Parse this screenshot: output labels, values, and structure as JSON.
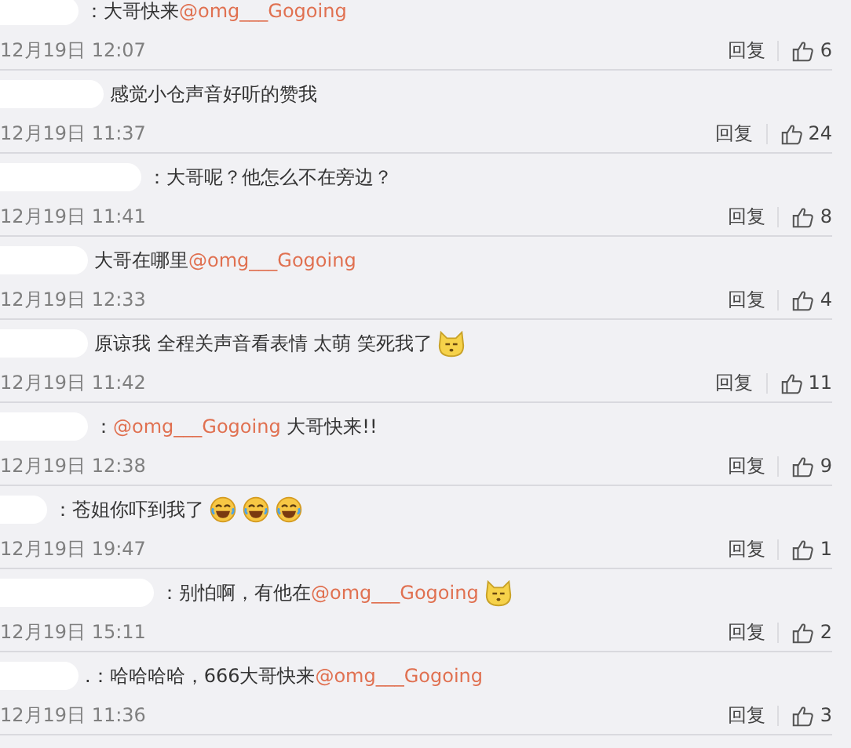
{
  "comments": [
    {
      "content": [
        {
          "kind": "text",
          "text": "：大哥快来"
        },
        {
          "kind": "mention",
          "text": "@omg___Gogoing"
        }
      ],
      "time": "12月19日 12:07",
      "reply": "回复",
      "likes": "6"
    },
    {
      "content": [
        {
          "kind": "text",
          "text": "感觉小仓声音好听的赞我"
        }
      ],
      "time": "12月19日 11:37",
      "reply": "回复",
      "likes": "24"
    },
    {
      "content": [
        {
          "kind": "text",
          "text": "：大哥呢？他怎么不在旁边？"
        }
      ],
      "time": "12月19日 11:41",
      "reply": "回复",
      "likes": "8"
    },
    {
      "content": [
        {
          "kind": "text",
          "text": "大哥在哪里"
        },
        {
          "kind": "mention",
          "text": "@omg___Gogoing"
        }
      ],
      "time": "12月19日 12:33",
      "reply": "回复",
      "likes": "4"
    },
    {
      "content": [
        {
          "kind": "text",
          "text": "原谅我 全程关声音看表情 太萌 笑死我了"
        },
        {
          "kind": "doge"
        }
      ],
      "time": "12月19日 11:42",
      "reply": "回复",
      "likes": "11"
    },
    {
      "content": [
        {
          "kind": "text",
          "text": "："
        },
        {
          "kind": "mention",
          "text": "@omg___Gogoing"
        },
        {
          "kind": "text",
          "text": " 大哥快来!!"
        }
      ],
      "time": "12月19日 12:38",
      "reply": "回复",
      "likes": "9"
    },
    {
      "content": [
        {
          "kind": "text",
          "text": "：苍姐你吓到我了"
        },
        {
          "kind": "laugh"
        },
        {
          "kind": "laugh"
        },
        {
          "kind": "laugh"
        }
      ],
      "time": "12月19日 19:47",
      "reply": "回复",
      "likes": "1"
    },
    {
      "content": [
        {
          "kind": "text",
          "text": "：别怕啊，有他在"
        },
        {
          "kind": "mention",
          "text": "@omg___Gogoing"
        },
        {
          "kind": "doge"
        }
      ],
      "time": "12月19日 15:11",
      "reply": "回复",
      "likes": "2"
    },
    {
      "content": [
        {
          "kind": "text",
          "text": ".：哈哈哈哈，666大哥快来"
        },
        {
          "kind": "mention",
          "text": "@omg___Gogoing"
        }
      ],
      "time": "12月19日 11:36",
      "reply": "回复",
      "likes": "3"
    }
  ]
}
